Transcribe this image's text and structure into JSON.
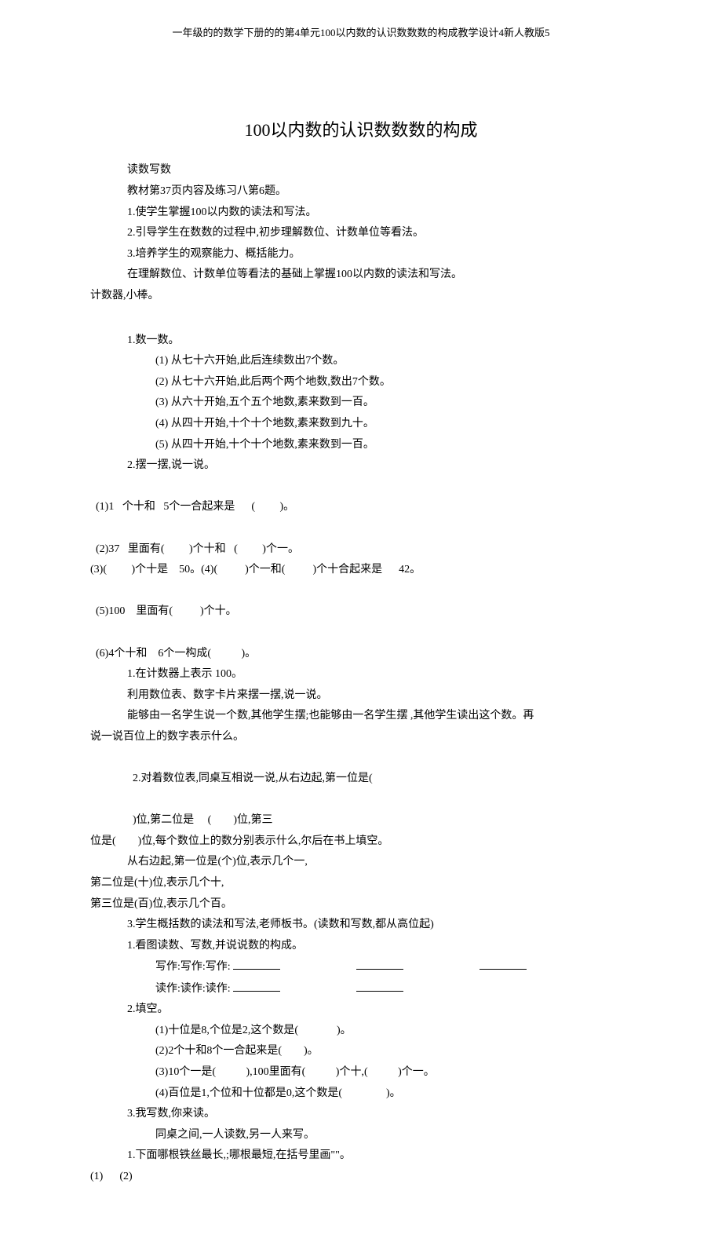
{
  "header": "一年级的的数学下册的的第4单元100以内数的认识数数数的构成教学设计4新人教版5",
  "title": "100以内数的认识数数数的构成",
  "intro": {
    "l1": "读数写数",
    "l2": "教材第37页内容及练习八第6题。",
    "l3": "1.使学生掌握100以内数的读法和写法。",
    "l4": "2.引导学生在数数的过程中,初步理解数位、计数单位等看法。",
    "l5": "3.培养学生的观察能力、概括能力。",
    "l6": "在理解数位、计数单位等看法的基础上掌握100以内数的读法和写法。",
    "l7": "计数器,小棒。"
  },
  "section_count": {
    "head": "1.数一数。",
    "i1": "(1)  从七十六开始,此后连续数出7个数。",
    "i2": "(2)  从七十六开始,此后两个两个地数,数出7个数。",
    "i3": "(3)  从六十开始,五个五个地数,素来数到一百。",
    "i4": "(4)  从四十开始,十个十个地数,素来数到九十。",
    "i5": "(5)  从四十开始,十个十个地数,素来数到一百。"
  },
  "section_place": {
    "head": "2.摆一摆,说一说。",
    "row1_a": "(1)1   个十和   5个一合起来是      (         )。",
    "row1_b": "(2)37   里面有(         )个十和   (         )个一。",
    "row2_a": "(3)(         )个十是    50。(4)(          )个一和(          )个十合起来是      42。",
    "row3_a": "(5)100    里面有(          )个十。",
    "row3_b": "(6)4个十和    6个一构成(           )。"
  },
  "explain": {
    "l1": "1.在计数器上表示      100。",
    "l2": "利用数位表、数字卡片来摆一摆,说一说。",
    "l3": "能够由一名学生说一个数,其他学生摆;也能够由一名学生摆           ,其他学生读出这个数。再",
    "l4": "说一说百位上的数字表示什么。",
    "l5_a": "2.对着数位表,同桌互相说一说,从右边起,第一位是(",
    "l5_b": ")位,第二位是     (        )位,第三",
    "l6": "位是(        )位,每个数位上的数分别表示什么,尔后在书上填空。",
    "l7": "从右边起,第一位是(个)位,表示几个一,",
    "l8": "第二位是(十)位,表示几个十,",
    "l9": "第三位是(百)位,表示几个百。",
    "l10": "3.学生概括数的读法和写法,老师板书。(读数和写数,都从高位起)"
  },
  "practice": {
    "l1": "1.看图读数、写数,并说说数的构成。",
    "write_label": "写作:写作:写作:",
    "read_label": "读作:读作:读作:",
    "l2": "2.填空。",
    "f1": "(1)十位是8,个位是2,这个数是(              )。",
    "f2": "(2)2个十和8个一合起来是(        )。",
    "f3": "(3)10个一是(           ),100里面有(           )个十,(           )个一。",
    "f4": "(4)百位是1,个位和十位都是0,这个数是(                )。",
    "l3": "3.我写数,你来读。",
    "l3a": "同桌之间,一人读数,另一人来写。",
    "l4": "1.下面哪根铁丝最长,;哪根最短,在括号里画\"\"。",
    "l5": "(1)      (2)"
  }
}
